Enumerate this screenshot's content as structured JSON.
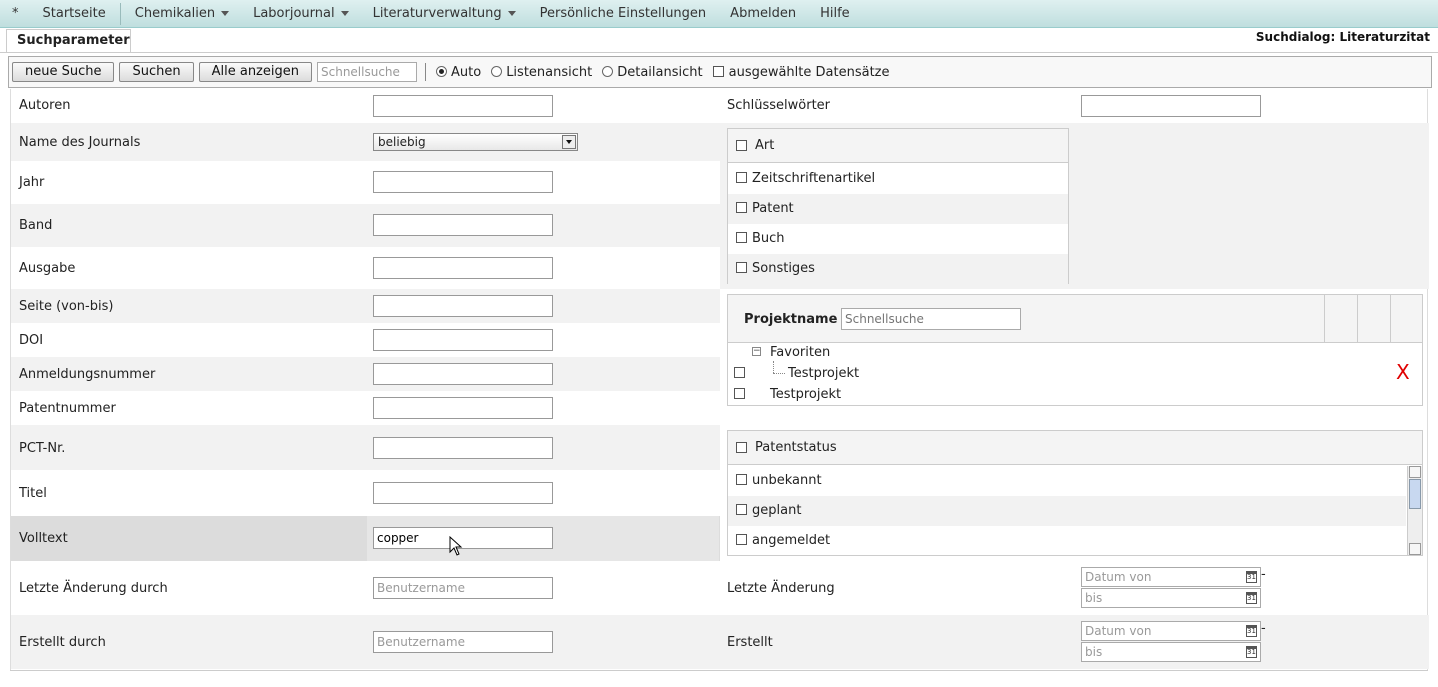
{
  "menu": {
    "star": "*",
    "items": [
      "Startseite",
      "Chemikalien",
      "Laborjournal",
      "Literaturverwaltung",
      "Persönliche Einstellungen",
      "Abmelden",
      "Hilfe"
    ]
  },
  "tab": {
    "label": "Suchparameter"
  },
  "dialog_title": "Suchdialog: Literaturzitat",
  "toolbar": {
    "new_search": "neue Suche",
    "search": "Suchen",
    "show_all": "Alle anzeigen",
    "quicksearch_placeholder": "Schnellsuche",
    "view_auto": "Auto",
    "view_list": "Listenansicht",
    "view_detail": "Detailansicht",
    "selected_records": "ausgewählte Datensätze",
    "selected_view": "Auto"
  },
  "left_fields": {
    "autoren": "Autoren",
    "journal": "Name des Journals",
    "journal_value": "beliebig",
    "jahr": "Jahr",
    "band": "Band",
    "ausgabe": "Ausgabe",
    "seite": "Seite (von-bis)",
    "doi": "DOI",
    "anmeldungsnummer": "Anmeldungsnummer",
    "patentnummer": "Patentnummer",
    "pct": "PCT-Nr.",
    "titel": "Titel",
    "volltext": "Volltext",
    "volltext_value": "copper",
    "letzte_aenderung_durch": "Letzte Änderung durch",
    "erstellt_durch": "Erstellt durch",
    "username_placeholder": "Benutzername"
  },
  "right_fields": {
    "schluesselwoerter": "Schlüsselwörter",
    "art": {
      "header": "Art",
      "options": [
        "Zeitschriftenartikel",
        "Patent",
        "Buch",
        "Sonstiges"
      ]
    },
    "projekt": {
      "header": "Projektname",
      "search_placeholder": "Schnellsuche",
      "tree_group": "Favoriten",
      "tree_child": "Testprojekt",
      "root_item": "Testprojekt",
      "remove_mark": "X"
    },
    "patentstatus": {
      "header": "Patentstatus",
      "options": [
        "unbekannt",
        "geplant",
        "angemeldet"
      ]
    },
    "letzte_aenderung": "Letzte Änderung",
    "erstellt": "Erstellt",
    "date_from_placeholder": "Datum von",
    "date_to_placeholder": "bis",
    "date_sep": "-",
    "calendar_day": "31"
  },
  "colors": {
    "menu_bg": "#cce6e6",
    "row_alt": "#f2f2f2",
    "remove_red": "#e00000"
  }
}
